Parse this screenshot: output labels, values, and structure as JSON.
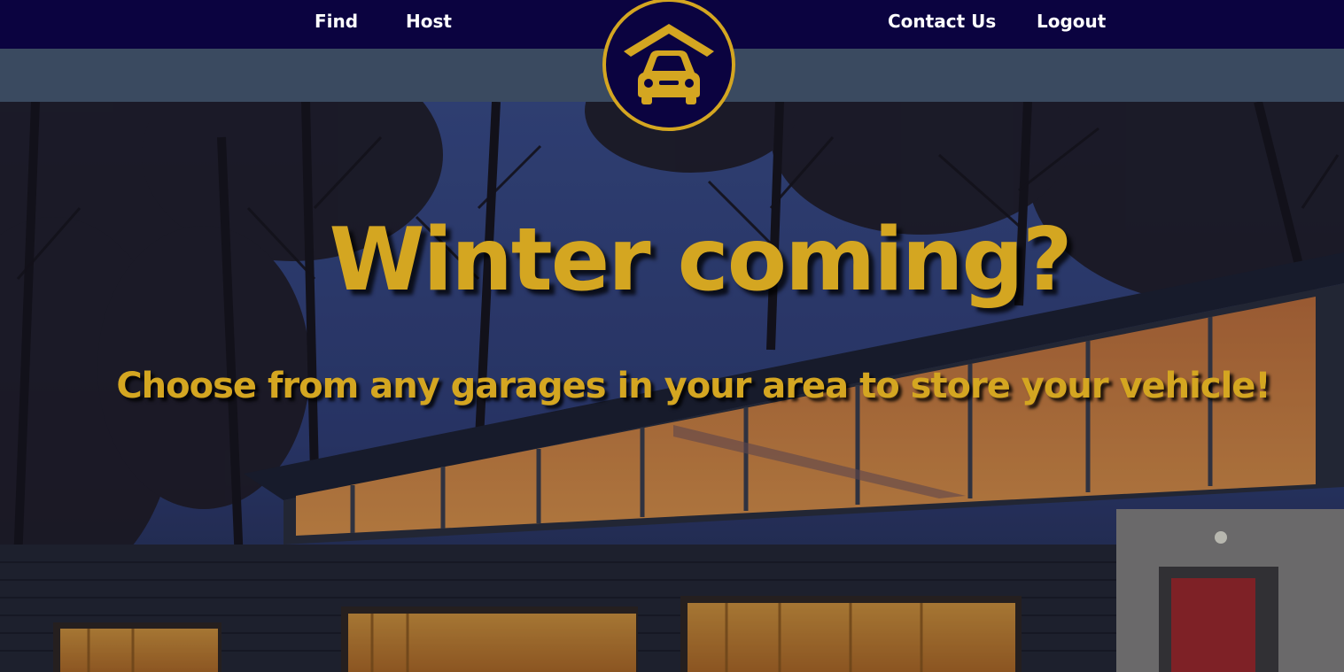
{
  "nav": {
    "find_label": "Find",
    "host_label": "Host",
    "contact_label": "Contact Us",
    "logout_label": "Logout"
  },
  "logo": {
    "icon": "garage-car-icon"
  },
  "hero": {
    "headline": "Winter coming?",
    "subheadline": "Choose from any garages in your area to store your vehicle!",
    "background_image": "lit-garage-at-dusk-photo"
  },
  "colors": {
    "nav_background": "#0b0340",
    "subbar_background": "#3a4a60",
    "accent_gold": "#d4a621",
    "nav_text": "#ffffff"
  }
}
